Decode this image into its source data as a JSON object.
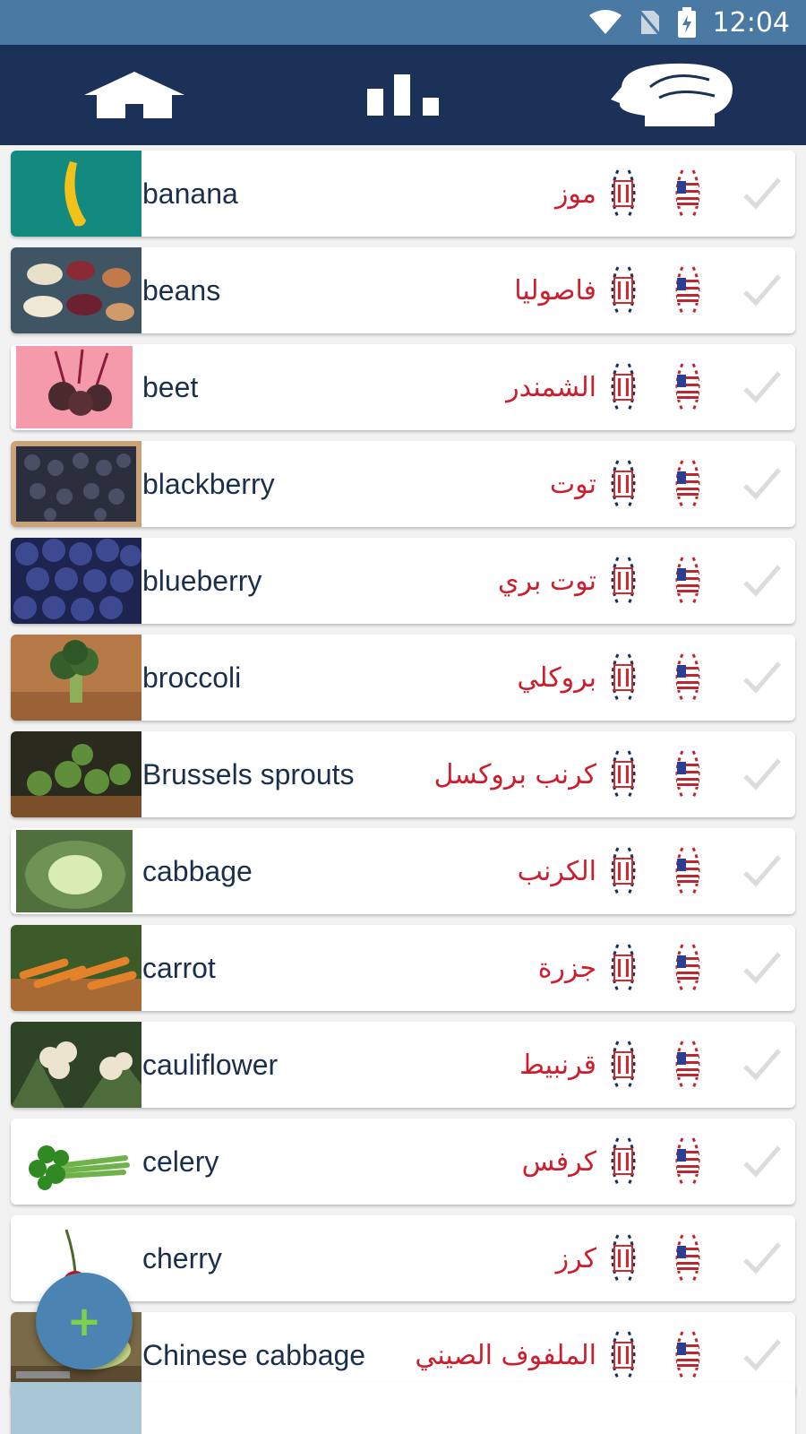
{
  "status": {
    "time": "12:04",
    "icons": [
      "wifi-icon",
      "no-sim-icon",
      "battery-charging-icon"
    ]
  },
  "nav": {
    "items": [
      {
        "name": "home",
        "icon": "home-icon"
      },
      {
        "name": "stats",
        "icon": "bar-chart-icon"
      },
      {
        "name": "brain",
        "icon": "brain-head-icon"
      }
    ]
  },
  "colors": {
    "status_bar": "#4a7aa3",
    "app_bar": "#1b3157",
    "word_text": "#1b2f4d",
    "translation_text": "#cc1f2e",
    "fab": "#4b84b3",
    "fab_plus": "#7bd34a"
  },
  "words": [
    {
      "word": "banana",
      "translation": "موز",
      "thumb_color": "#128a80"
    },
    {
      "word": "beans",
      "translation": "فاصوليا",
      "thumb_color": "#3f5563"
    },
    {
      "word": "beet",
      "translation": "الشمندر",
      "thumb_color": "#f49aaa"
    },
    {
      "word": "blackberry",
      "translation": "توت",
      "thumb_color": "#2b2f3d"
    },
    {
      "word": "blueberry",
      "translation": "توت بري",
      "thumb_color": "#2a3369"
    },
    {
      "word": "broccoli",
      "translation": "بروكلي",
      "thumb_color": "#b57a48"
    },
    {
      "word": "Brussels sprouts",
      "translation": "كرنب بروكسل",
      "thumb_color": "#3e5a2a"
    },
    {
      "word": "cabbage",
      "translation": "الكرنب",
      "thumb_color": "#6f9354"
    },
    {
      "word": "carrot",
      "translation": "جزرة",
      "thumb_color": "#d97a2b"
    },
    {
      "word": "cauliflower",
      "translation": "قرنبيط",
      "thumb_color": "#4d6b3b"
    },
    {
      "word": "celery",
      "translation": "كرفس",
      "thumb_color": "#ffffff"
    },
    {
      "word": "cherry",
      "translation": "كرز",
      "thumb_color": "#ffffff"
    },
    {
      "word": "Chinese cabbage",
      "translation": "الملفوف الصيني",
      "thumb_color": "#9a8a5a"
    }
  ],
  "fab": {
    "label": "+"
  }
}
